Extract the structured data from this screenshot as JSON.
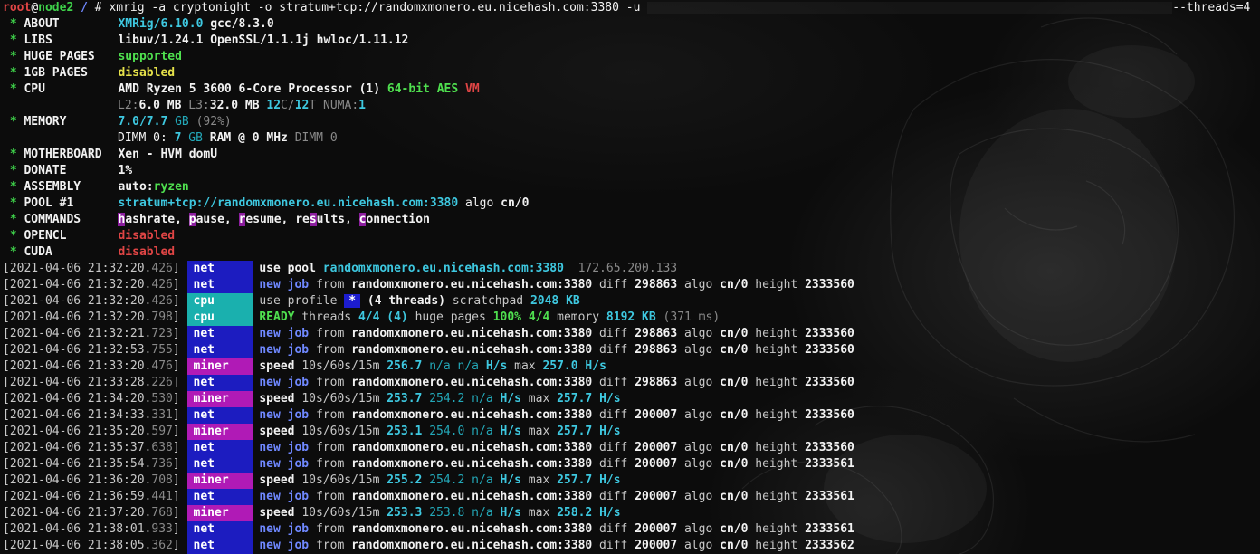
{
  "prompt": {
    "user": "root",
    "at": "@",
    "host": "node2",
    "path": "/",
    "symbol": "#",
    "command": "xmrig -a cryptonight -o stratum+tcp://randomxmonero.eu.nicehash.com:3380 -u",
    "command_tail": "--threads=4"
  },
  "summary": {
    "bullet": "*",
    "about": {
      "key": "ABOUT",
      "name": "XMRig/6.10.0",
      "compiler": "gcc/8.3.0"
    },
    "libs": {
      "key": "LIBS",
      "value": "libuv/1.24.1 OpenSSL/1.1.1j hwloc/1.11.12"
    },
    "huge_pages": {
      "key": "HUGE PAGES",
      "value": "supported"
    },
    "one_gb_pages": {
      "key": "1GB PAGES",
      "value": "disabled"
    },
    "cpu": {
      "key": "CPU",
      "model": "AMD Ryzen 5 3600 6-Core Processor (1)",
      "bits": "64-bit",
      "aes": "AES",
      "vm": "VM",
      "l2_label": "L2:",
      "l2": "6.0 MB",
      "l3_label": "L3:",
      "l3": "32.0 MB",
      "cores": "12",
      "cores_suffix": "C/",
      "threads": "12",
      "threads_suffix": "T",
      "numa_label": "NUMA:",
      "numa": "1"
    },
    "memory": {
      "key": "MEMORY",
      "used": "7.0/7.7",
      "unit": "GB",
      "pct": "(92%)",
      "dimm_label": "DIMM 0:",
      "dimm_size": "7",
      "dimm_unit": "GB",
      "dimm_rest": "RAM @ 0 MHz",
      "dimm_tail": "DIMM 0"
    },
    "motherboard": {
      "key": "MOTHERBOARD",
      "value": "Xen - HVM domU"
    },
    "donate": {
      "key": "DONATE",
      "value": "1%"
    },
    "assembly": {
      "key": "ASSEMBLY",
      "prefix": "auto:",
      "value": "ryzen"
    },
    "pool": {
      "key": "POOL #1",
      "url": "stratum+tcp://randomxmonero.eu.nicehash.com:3380",
      "algo_label": "algo",
      "algo": "cn/0"
    },
    "commands": {
      "key": "COMMANDS",
      "items": [
        {
          "hot": "h",
          "rest": "ashrate",
          "pre": ""
        },
        {
          "hot": "p",
          "rest": "ause",
          "pre": ""
        },
        {
          "hot": "r",
          "rest": "esume",
          "pre": ""
        },
        {
          "hot": "s",
          "rest": "ults",
          "pre": "re"
        },
        {
          "hot": "c",
          "rest": "onnection",
          "pre": ""
        }
      ]
    },
    "opencl": {
      "key": "OPENCL",
      "value": "disabled"
    },
    "cuda": {
      "key": "CUDA",
      "value": "disabled"
    }
  },
  "log": [
    {
      "date": "2021-04-06 21:32:20",
      "ms": "426",
      "tag": "net",
      "type": "pool",
      "host": "randomxmonero.eu.nicehash.com:3380",
      "ip": "172.65.200.133"
    },
    {
      "date": "2021-04-06 21:32:20",
      "ms": "426",
      "tag": "net",
      "type": "job",
      "host": "randomxmonero.eu.nicehash.com:3380",
      "diff": "298863",
      "algo": "cn/0",
      "height": "2333560"
    },
    {
      "date": "2021-04-06 21:32:20",
      "ms": "426",
      "tag": "cpu",
      "type": "profile",
      "profile": "*",
      "threads": "(4 threads)",
      "scratchpad": "2048 KB"
    },
    {
      "date": "2021-04-06 21:32:20",
      "ms": "798",
      "tag": "cpu",
      "type": "ready",
      "threads": "4/4 (4)",
      "huge_pct": "100%",
      "huge_ratio": "4/4",
      "memory": "8192 KB",
      "elapsed": "(371 ms)"
    },
    {
      "date": "2021-04-06 21:32:21",
      "ms": "723",
      "tag": "net",
      "type": "job",
      "host": "randomxmonero.eu.nicehash.com:3380",
      "diff": "298863",
      "algo": "cn/0",
      "height": "2333560"
    },
    {
      "date": "2021-04-06 21:32:53",
      "ms": "755",
      "tag": "net",
      "type": "job",
      "host": "randomxmonero.eu.nicehash.com:3380",
      "diff": "298863",
      "algo": "cn/0",
      "height": "2333560"
    },
    {
      "date": "2021-04-06 21:33:20",
      "ms": "476",
      "tag": "miner",
      "type": "speed",
      "s10": "256.7",
      "s60": "n/a",
      "s15": "n/a",
      "max": "257.0"
    },
    {
      "date": "2021-04-06 21:33:28",
      "ms": "226",
      "tag": "net",
      "type": "job",
      "host": "randomxmonero.eu.nicehash.com:3380",
      "diff": "298863",
      "algo": "cn/0",
      "height": "2333560"
    },
    {
      "date": "2021-04-06 21:34:20",
      "ms": "530",
      "tag": "miner",
      "type": "speed",
      "s10": "253.7",
      "s60": "254.2",
      "s15": "n/a",
      "max": "257.7"
    },
    {
      "date": "2021-04-06 21:34:33",
      "ms": "331",
      "tag": "net",
      "type": "job",
      "host": "randomxmonero.eu.nicehash.com:3380",
      "diff": "200007",
      "algo": "cn/0",
      "height": "2333560"
    },
    {
      "date": "2021-04-06 21:35:20",
      "ms": "597",
      "tag": "miner",
      "type": "speed",
      "s10": "253.1",
      "s60": "254.0",
      "s15": "n/a",
      "max": "257.7"
    },
    {
      "date": "2021-04-06 21:35:37",
      "ms": "638",
      "tag": "net",
      "type": "job",
      "host": "randomxmonero.eu.nicehash.com:3380",
      "diff": "200007",
      "algo": "cn/0",
      "height": "2333560"
    },
    {
      "date": "2021-04-06 21:35:54",
      "ms": "736",
      "tag": "net",
      "type": "job",
      "host": "randomxmonero.eu.nicehash.com:3380",
      "diff": "200007",
      "algo": "cn/0",
      "height": "2333561"
    },
    {
      "date": "2021-04-06 21:36:20",
      "ms": "708",
      "tag": "miner",
      "type": "speed",
      "s10": "255.2",
      "s60": "254.2",
      "s15": "n/a",
      "max": "257.7"
    },
    {
      "date": "2021-04-06 21:36:59",
      "ms": "441",
      "tag": "net",
      "type": "job",
      "host": "randomxmonero.eu.nicehash.com:3380",
      "diff": "200007",
      "algo": "cn/0",
      "height": "2333561"
    },
    {
      "date": "2021-04-06 21:37:20",
      "ms": "768",
      "tag": "miner",
      "type": "speed",
      "s10": "253.3",
      "s60": "253.8",
      "s15": "n/a",
      "max": "258.2"
    },
    {
      "date": "2021-04-06 21:38:01",
      "ms": "933",
      "tag": "net",
      "type": "job",
      "host": "randomxmonero.eu.nicehash.com:3380",
      "diff": "200007",
      "algo": "cn/0",
      "height": "2333561"
    },
    {
      "date": "2021-04-06 21:38:05",
      "ms": "362",
      "tag": "net",
      "type": "job",
      "host": "randomxmonero.eu.nicehash.com:3380",
      "diff": "200007",
      "algo": "cn/0",
      "height": "2333562"
    }
  ],
  "labels": {
    "use_pool": "use pool",
    "new": "new",
    "job": "job",
    "from": "from",
    "diff": "diff",
    "algo": "algo",
    "height": "height",
    "use_profile": "use profile",
    "scratchpad": "scratchpad",
    "ready": "READY",
    "threads": "threads",
    "huge_pages": "huge pages",
    "memory": "memory",
    "speed": "speed",
    "windows": "10s/60s/15m",
    "hs": "H/s",
    "max": "max"
  },
  "colors": {
    "prompt_user": "#e04545",
    "tag_net": "#1c1cc0",
    "tag_cpu": "#1ab0ae",
    "tag_miner": "#b01ab6",
    "accent_cyan": "#3ec8e0",
    "accent_green": "#3ed24a"
  }
}
